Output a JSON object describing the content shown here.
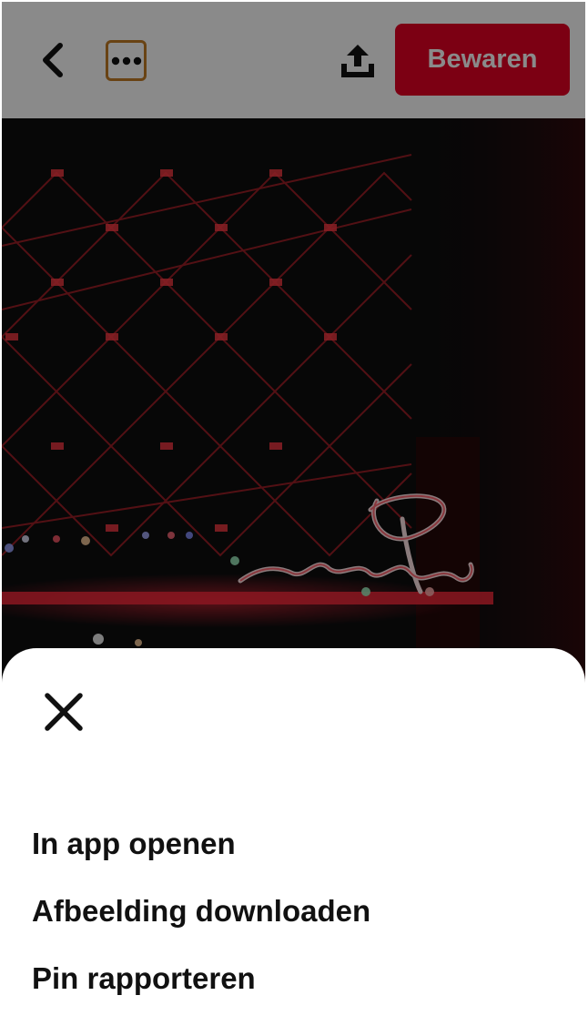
{
  "header": {
    "back_icon": "chevron-left-icon",
    "more_icon": "ellipsis-icon",
    "share_icon": "share-upload-icon",
    "save_label": "Bewaren",
    "save_color": "#e60023",
    "focus_ring_color": "#c37c25"
  },
  "pin": {
    "image": "neon-sign-photo"
  },
  "sheet": {
    "close_icon": "close-icon",
    "items": [
      {
        "label": "In app openen"
      },
      {
        "label": "Afbeelding downloaden"
      },
      {
        "label": "Pin rapporteren"
      }
    ]
  }
}
